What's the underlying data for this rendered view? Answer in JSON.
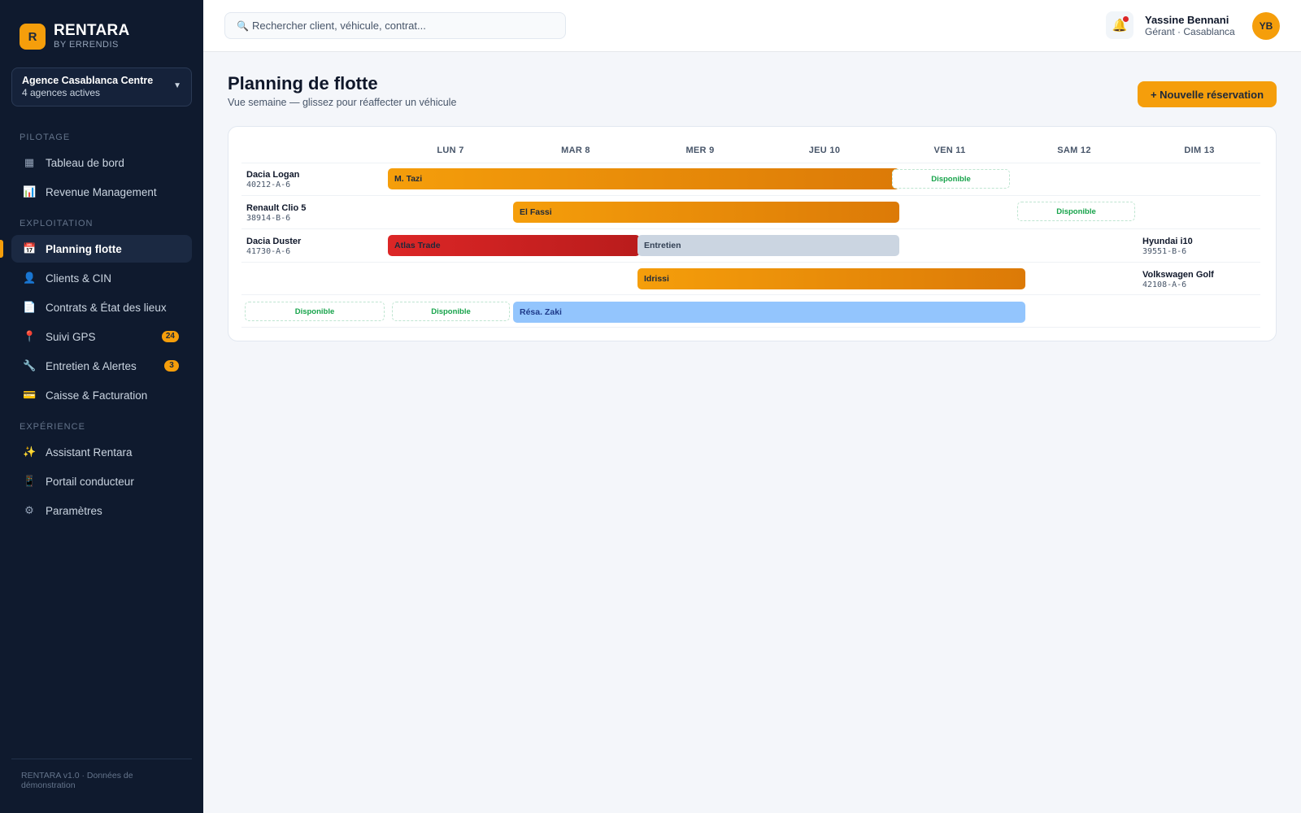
{
  "brand": {
    "logo_letter": "R",
    "name": "RENTARA",
    "sub": "BY ERRENDIS"
  },
  "agency": {
    "name": "Agence Casablanca Centre",
    "sub": "4 agences actives"
  },
  "sections": {
    "pilotage": "PILOTAGE",
    "exploitation": "EXPLOITATION",
    "experience": "EXPÉRIENCE"
  },
  "nav": [
    {
      "label": "Tableau de bord",
      "icon": "grid-icon"
    },
    {
      "label": "Revenue Management",
      "icon": "chart-icon"
    },
    {
      "label": "Planning flotte",
      "icon": "calendar-icon",
      "active": true
    },
    {
      "label": "Clients & CIN",
      "icon": "user-icon"
    },
    {
      "label": "Contrats & État des lieux",
      "icon": "document-icon"
    },
    {
      "label": "Suivi GPS",
      "icon": "pin-icon",
      "badge": "24"
    },
    {
      "label": "Entretien & Alertes",
      "icon": "wrench-icon",
      "badge": "3"
    },
    {
      "label": "Caisse & Facturation",
      "icon": "card-icon"
    },
    {
      "label": "Assistant Rentara",
      "icon": "sparkles-icon"
    },
    {
      "label": "Portail conducteur",
      "icon": "phone-icon"
    },
    {
      "label": "Paramètres",
      "icon": "gear-icon"
    }
  ],
  "footer": "RENTARA v1.0 · Données de démonstration",
  "search": {
    "placeholder": "Rechercher client, véhicule, contrat..."
  },
  "user": {
    "name": "Yassine Bennani",
    "role": "Gérant · Casablanca",
    "initials": "YB"
  },
  "page": {
    "title": "Planning de flotte",
    "subtitle": "Vue semaine — glissez pour réaffecter un véhicule",
    "new_button": "+ Nouvelle réservation"
  },
  "days": [
    "LUN 7",
    "MAR 8",
    "MER 9",
    "JEU 10",
    "VEN 11",
    "SAM 12",
    "DIM 13"
  ],
  "vehicles": [
    {
      "name": "Dacia Logan",
      "plate": "40212-A-6"
    },
    {
      "name": "Renault Clio 5",
      "plate": "38914-B-6"
    },
    {
      "name": "Dacia Duster",
      "plate": "41730-A-6"
    },
    {
      "name": "Hyundai i10",
      "plate": "39551-B-6"
    },
    {
      "name": "Volkswagen Golf",
      "plate": "42108-A-6"
    }
  ],
  "bookings": [
    {
      "label": "M. Tazi",
      "type": "rental",
      "color": "#f59e0b"
    },
    {
      "label": "El Fassi",
      "type": "rental",
      "color": "#f59e0b"
    },
    {
      "label": "Atlas Trade",
      "type": "rental",
      "color": "#dc2626"
    },
    {
      "label": "Entretien",
      "type": "maintenance",
      "color": "#cbd5e1"
    },
    {
      "label": "Idrissi",
      "type": "rental",
      "color": "#f59e0b"
    },
    {
      "label": "Résa. Zaki",
      "type": "reservation",
      "color": "#93c5fd"
    }
  ],
  "available_label": "Disponible",
  "colors": {
    "sidebar": "#0f1a2e",
    "accent": "#f59e0b",
    "available": "#16a34a"
  }
}
